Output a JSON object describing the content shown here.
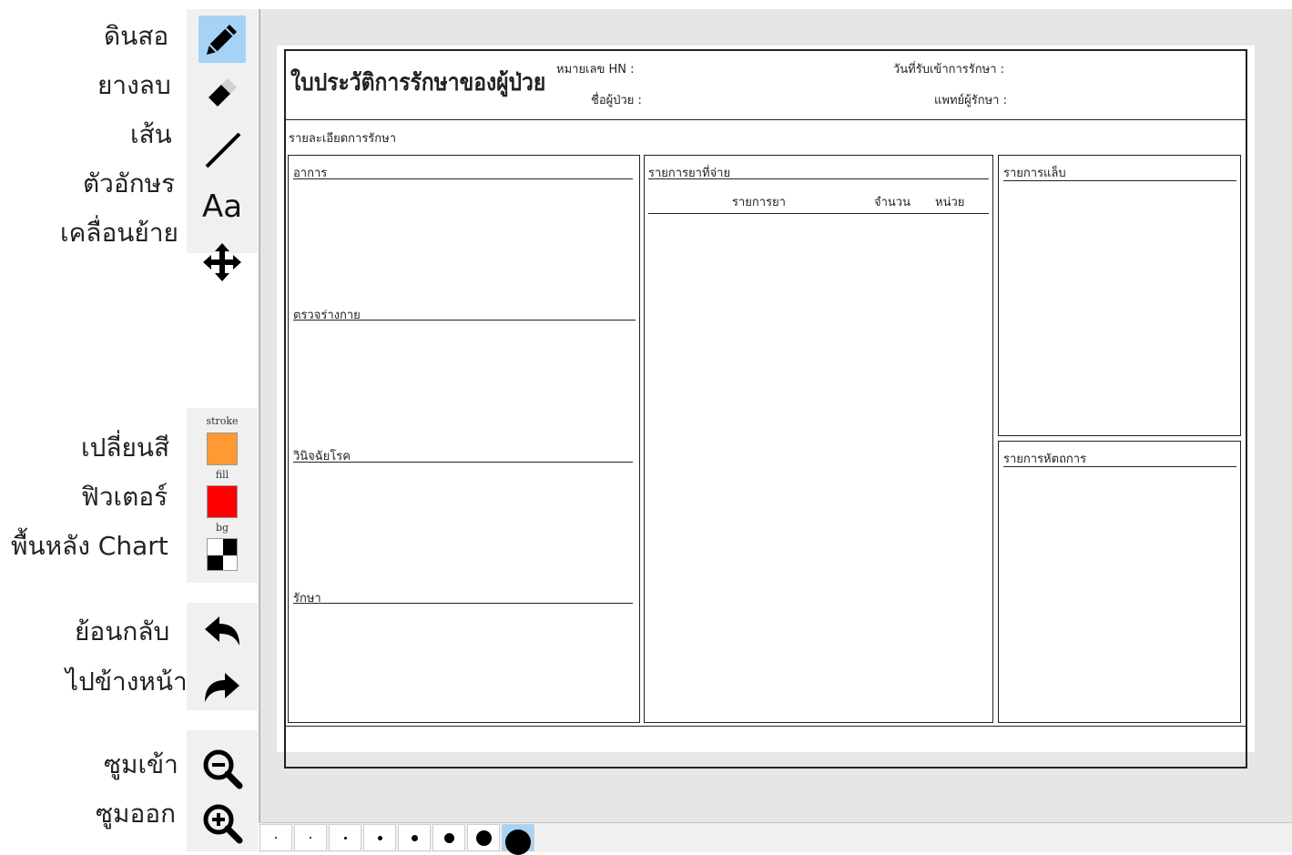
{
  "toolbar": {
    "pencil_label": "ดินสอ",
    "eraser_label": "ยางลบ",
    "line_label": "เส้น",
    "text_label": "ตัวอักษร",
    "text_icon_glyph": "Aa",
    "move_label": "เคลื่อนย้าย",
    "change_color_label": "เปลี่ยนสี",
    "fill_label": "ฟิวเตอร์",
    "background_label": "พื้นหลัง Chart",
    "undo_label": "ย้อนกลับ",
    "redo_label": "ไปข้างหน้า",
    "zoom_in_label": "ซูมเข้า",
    "zoom_out_label": "ซูมออก",
    "active_tool": "pencil",
    "swatches": {
      "stroke_label": "stroke",
      "stroke_color": "#ff9933",
      "fill_label": "fill",
      "fill_color": "#ff0000",
      "bg_label": "bg"
    }
  },
  "form": {
    "title": "ใบประวัติการรักษาของผู้ป่วย",
    "hn_label": "หมายเลข HN :",
    "patient_name_label": "ชื่อผู้ป่วย :",
    "admit_date_label": "วันที่รับเข้าการรักษา :",
    "doctor_label": "แพทย์ผู้รักษา :",
    "details_heading": "รายละเอียดการรักษา",
    "symptoms_label": "อาการ",
    "physical_exam_label": "ตรวจร่างกาย",
    "diagnosis_label": "วินิจฉัยโรค",
    "treatment_label": "รักษา",
    "dispensed_meds_label": "รายการยาที่จ่าย",
    "med_columns": [
      "รายการยา",
      "จำนวน",
      "หน่วย"
    ],
    "lab_label": "รายการแล็บ",
    "procedures_label": "รายการหัตถการ"
  },
  "brush_sizes": {
    "count": 8,
    "selected_index": 7
  }
}
